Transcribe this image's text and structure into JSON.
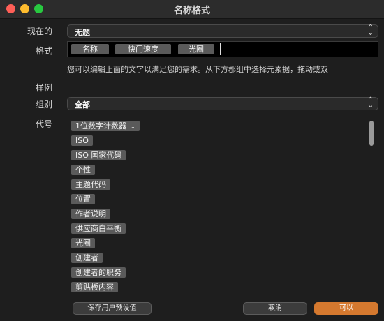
{
  "window": {
    "title": "名称格式"
  },
  "current": {
    "label": "现在的",
    "value": "无题"
  },
  "format": {
    "label": "格式",
    "tokens": [
      "名称",
      "快门速度",
      "光圈"
    ]
  },
  "hint": "您可以编辑上面的文字以满足您的需求。从下方郡组中选择元素据，拖动或双",
  "example": {
    "label": "样例"
  },
  "group": {
    "label": "组别",
    "value": "全部"
  },
  "code": {
    "label": "代号",
    "items": [
      "1位数字计数器",
      "ISO",
      "ISO 国家代码",
      "个性",
      "主题代码",
      "位置",
      "作者说明",
      "供应商白平衡",
      "光圈",
      "创建者",
      "创建者的职务",
      "剪贴板内容"
    ]
  },
  "buttons": {
    "save_preset": "保存用户预设值",
    "cancel": "取消",
    "ok": "可以"
  },
  "colors": {
    "accent": "#d5792f",
    "chip": "#5a5a5a",
    "background": "#1e1e1e"
  },
  "icons": {
    "popup_chevron": "chevron-updown-icon",
    "chip_dropdown": "chevron-down-icon"
  }
}
